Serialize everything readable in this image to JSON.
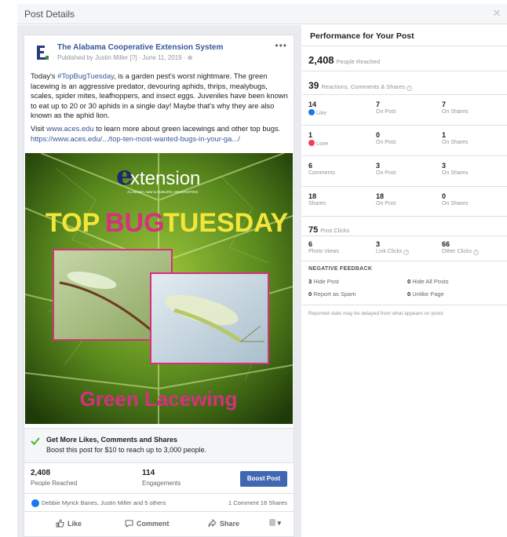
{
  "dialog": {
    "title": "Post Details",
    "close_icon": "close-icon"
  },
  "post": {
    "page_name": "The Alabama Cooperative Extension System",
    "meta": "Published by Justin Miller [?] · June 11, 2019 · ",
    "text_1_pre": "Today's ",
    "hashtag": "#TopBugTuesday",
    "text_1_post": ", is a garden pest's worst nightmare. The green lacewing is an aggressive predator, devouring aphids, thrips, mealybugs, scales, spider mites, leafhoppers, and insect eggs. Juveniles have been known to eat up to 20 or 30 aphids in a single day! Maybe that's why they are also known as the aphid lion.",
    "text_2_pre": "Visit ",
    "site_link": "www.aces.edu",
    "text_2_post": " to learn more about green lacewings and other top bugs.",
    "long_link": "https://www.aces.edu/.../top-ten-most-wanted-bugs-in-your-ga.../",
    "image": {
      "brand_e": "e",
      "brand_rest": "xtension",
      "brand_sub": "ALABAMA A&M & AUBURN UNIVERSITIES",
      "headline_1": "TOP",
      "headline_2": "BUG",
      "headline_3": "TUESDAY",
      "caption": "Green Lacewing"
    }
  },
  "boost": {
    "title": "Get More Likes, Comments and Shares",
    "subtitle": "Boost this post for $10 to reach up to 3,000 people.",
    "button": "Boost Post"
  },
  "stats": {
    "reached_num": "2,408",
    "reached_lbl": "People Reached",
    "engagements_num": "114",
    "engagements_lbl": "Engagements"
  },
  "reactions": {
    "names": "Debbie Myrick Banes, Justin Miller and 5 others",
    "counts": "1 Comment  18 Shares"
  },
  "actions": {
    "like": "Like",
    "comment": "Comment",
    "share": "Share"
  },
  "performance": {
    "title": "Performance for Your Post",
    "reached_num": "2,408",
    "reached_lbl": "People Reached",
    "engage_num": "39",
    "engage_lbl": "Reactions, Comments & Shares",
    "rows": [
      [
        {
          "num": "14",
          "lbl": "Like",
          "icon": "like"
        },
        {
          "num": "7",
          "lbl": "On Post"
        },
        {
          "num": "7",
          "lbl": "On Shares"
        }
      ],
      [
        {
          "num": "1",
          "lbl": "Love",
          "icon": "love"
        },
        {
          "num": "0",
          "lbl": "On Post"
        },
        {
          "num": "1",
          "lbl": "On Shares"
        }
      ],
      [
        {
          "num": "6",
          "lbl": "Comments"
        },
        {
          "num": "3",
          "lbl": "On Post"
        },
        {
          "num": "3",
          "lbl": "On Shares"
        }
      ],
      [
        {
          "num": "18",
          "lbl": "Shares"
        },
        {
          "num": "18",
          "lbl": "On Post"
        },
        {
          "num": "0",
          "lbl": "On Shares"
        }
      ]
    ],
    "clicks_num": "75",
    "clicks_lbl": "Post Clicks",
    "clicks": [
      {
        "num": "6",
        "lbl": "Photo Views"
      },
      {
        "num": "3",
        "lbl": "Link Clicks"
      },
      {
        "num": "66",
        "lbl": "Other Clicks"
      }
    ],
    "negative_title": "NEGATIVE FEEDBACK",
    "neg": [
      {
        "num": "3",
        "lbl": "Hide Post"
      },
      {
        "num": "0",
        "lbl": "Hide All Posts"
      },
      {
        "num": "0",
        "lbl": "Report as Spam"
      },
      {
        "num": "0",
        "lbl": "Unlike Page"
      }
    ],
    "note": "Reported stats may be delayed from what appears on posts"
  },
  "colors": {
    "link": "#385898",
    "boost": "#4267b2",
    "like": "#1877f2",
    "love": "#f33e58",
    "pink": "#d6307f",
    "yellow": "#f3e53a"
  }
}
